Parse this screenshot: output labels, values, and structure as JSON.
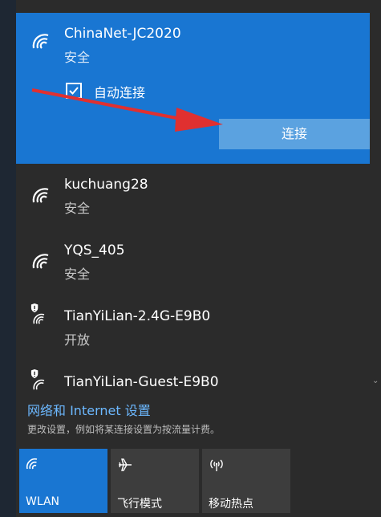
{
  "selected_network": {
    "name": "ChinaNet-JC2020",
    "status": "安全",
    "auto_connect_label": "自动连接",
    "auto_connect_checked": true,
    "connect_button": "连接"
  },
  "networks": [
    {
      "name": "kuchuang28",
      "status": "安全",
      "icon": "wifi-icon"
    },
    {
      "name": "YQS_405",
      "status": "安全",
      "icon": "wifi-icon"
    },
    {
      "name": "TianYiLian-2.4G-E9B0",
      "status": "开放",
      "icon": "wifi-open-shield-icon"
    },
    {
      "name": "TianYiLian-Guest-E9B0",
      "status": "",
      "icon": "wifi-open-shield-icon"
    }
  ],
  "settings": {
    "link": "网络和 Internet 设置",
    "description": "更改设置，例如将某连接设置为按流量计费。"
  },
  "quick_actions": [
    {
      "label": "WLAN",
      "icon": "wifi-icon",
      "active": true
    },
    {
      "label": "飞行模式",
      "icon": "airplane-icon",
      "active": false
    },
    {
      "label": "移动热点",
      "icon": "hotspot-icon",
      "active": false
    }
  ],
  "colors": {
    "accent": "#1976d2",
    "panel_bg": "#2b2b2b",
    "link": "#6cb8ff",
    "arrow": "#e03030"
  }
}
